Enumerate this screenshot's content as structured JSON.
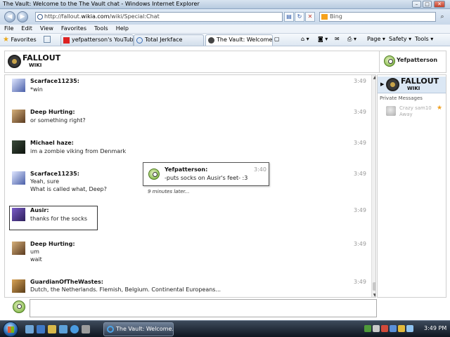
{
  "window": {
    "title": "The Vault: Welcome to the The Vault chat - Windows Internet Explorer",
    "minimize": "–",
    "maximize": "□",
    "close": "✕"
  },
  "addressbar": {
    "url_prefix": "http://fallout.",
    "url_domain": "wikia.com",
    "url_path": "/wiki/Special:Chat",
    "search_placeholder": "Bing"
  },
  "menu": [
    "File",
    "Edit",
    "View",
    "Favorites",
    "Tools",
    "Help"
  ],
  "favorites": {
    "label": "Favorites",
    "tabs": [
      {
        "label": "yefpatterson's YouTube ..."
      },
      {
        "label": "Total Jerkface"
      },
      {
        "label": "The Vault: Welcome ..."
      }
    ],
    "commands": [
      "Page ▾",
      "Safety ▾",
      "Tools ▾"
    ]
  },
  "wiki": {
    "logo_title": "FALLOUT",
    "logo_sub": "WIKI",
    "current_user": "Yefpatterson"
  },
  "messages": [
    {
      "user": "Scarface11235:",
      "lines": [
        "*win"
      ],
      "time": "3:49"
    },
    {
      "user": "Deep Hurting:",
      "lines": [
        "or something right?"
      ],
      "time": "3:49"
    },
    {
      "user": "Michael haze:",
      "lines": [
        "im a zombie viking from Denmark"
      ],
      "time": "3:49"
    },
    {
      "user": "Scarface11235:",
      "lines": [
        "Yeah, sure",
        "What is called what, Deep?"
      ],
      "time": "3:49"
    },
    {
      "user": "Ausir:",
      "lines": [
        "thanks for the socks"
      ],
      "time": "3:49"
    },
    {
      "user": "Deep Hurting:",
      "lines": [
        "um",
        "wait"
      ],
      "time": "3:49"
    },
    {
      "user": "GuardianOfTheWastes:",
      "lines": [
        "Dutch, the Netherlands. Flemish, Belgium. Continental Europeans..."
      ],
      "time": "3:49"
    }
  ],
  "popup": {
    "user": "Yefpatterson:",
    "line": "-puts socks on Ausir's feet- :3",
    "time": "3:40",
    "later": "9 minutes later..."
  },
  "sidebar": {
    "private_label": "Private Messages",
    "pm": {
      "name": "Crazy sam10",
      "status": "Away"
    }
  },
  "taskbar": {
    "window_button": "The Vault: Welcome...",
    "clock": "3:49 PM"
  }
}
